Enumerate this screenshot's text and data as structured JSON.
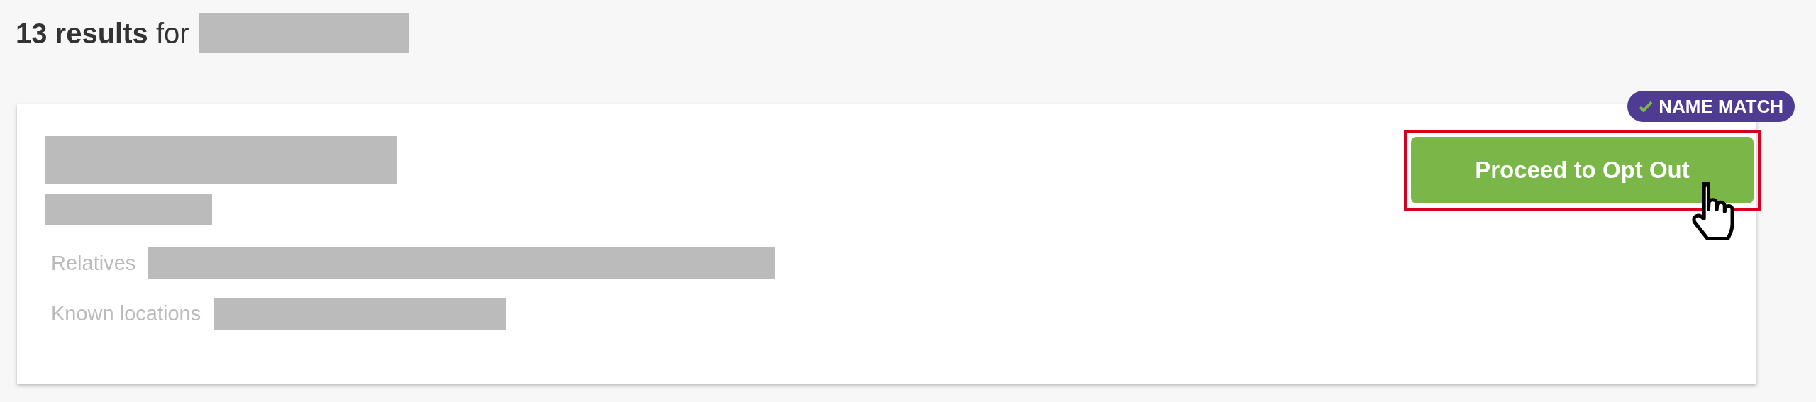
{
  "heading": "**13 results** for",
  "result": {
    "badge": {
      "label": "NAME MATCH"
    },
    "fields": [
      {
        "label": "Relatives"
      },
      {
        "label": "Known locations"
      }
    ],
    "button": {
      "label": "Proceed to Opt Out",
      "highlighted": true
    }
  }
}
